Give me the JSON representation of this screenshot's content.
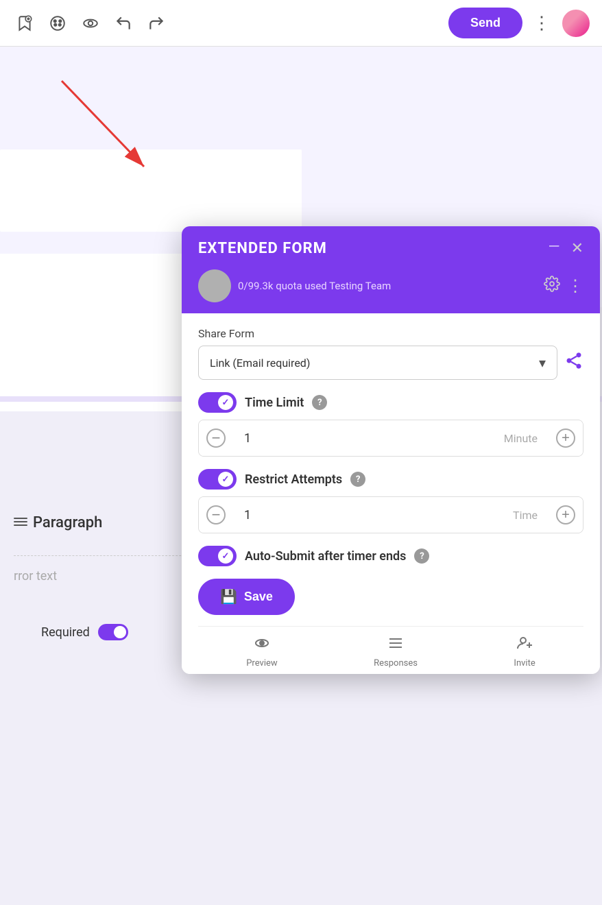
{
  "toolbar": {
    "send_label": "Send"
  },
  "background": {
    "paragraph_label": "Paragraph",
    "error_text": "rror text",
    "required_label": "Required"
  },
  "modal": {
    "title": "EXTENDED FORM",
    "minimize_label": "—",
    "close_label": "✕",
    "user_info": "0/99.3k quota used   Testing Team",
    "share_form_label": "Share Form",
    "share_select_value": "Link (Email required)",
    "time_limit_label": "Time Limit",
    "time_limit_value": "1",
    "time_limit_unit": "Minute",
    "restrict_attempts_label": "Restrict Attempts",
    "restrict_value": "1",
    "restrict_unit": "Time",
    "auto_submit_label": "Auto-Submit after timer ends",
    "save_label": "Save",
    "nav_preview": "Preview",
    "nav_responses": "Responses",
    "nav_invite": "Invite"
  }
}
